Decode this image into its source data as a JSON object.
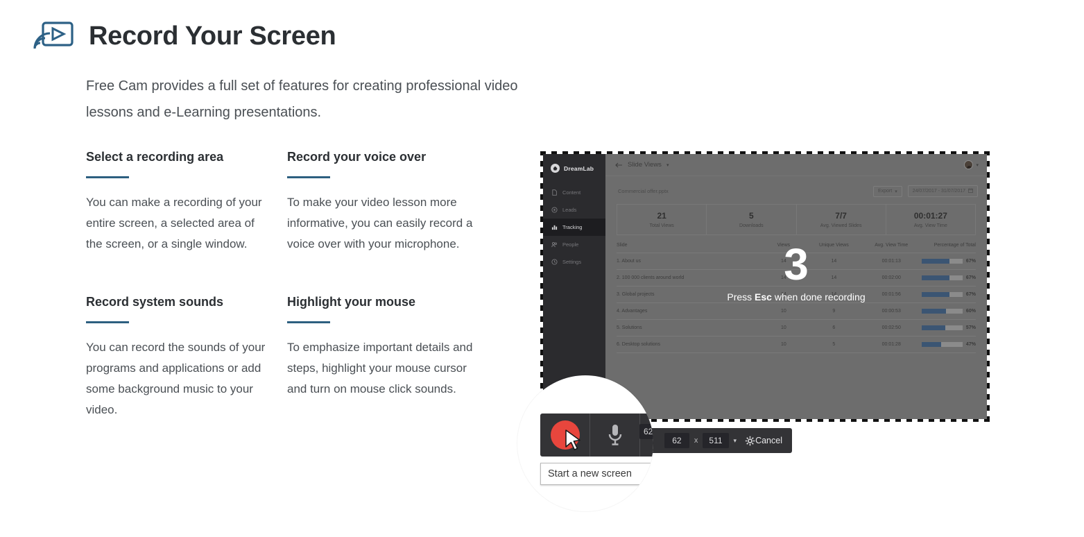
{
  "header": {
    "title": "Record Your Screen",
    "icon": "screen-record-icon",
    "accent_color": "#2d5f80",
    "intro": "Free Cam provides a full set of features for creating professional video lessons and e-Learning presentations."
  },
  "features": [
    {
      "title": "Select a recording area",
      "body": "You can make a recording of your entire screen, a selected area of the screen, or a single window."
    },
    {
      "title": "Record your voice over",
      "body": "To make your video lesson more informative, you can easily record a voice over with your microphone."
    },
    {
      "title": "Record system sounds",
      "body": "You can record the sounds of your programs and applications or add some background music to your video."
    },
    {
      "title": "Highlight your mouse",
      "body": "To emphasize important details and steps, highlight your mouse cursor and turn on mouse click sounds."
    }
  ],
  "screenshot": {
    "sidebar": {
      "logo": "DreamLab",
      "items": [
        {
          "label": "Content",
          "icon": "document-icon",
          "active": false
        },
        {
          "label": "Leads",
          "icon": "target-icon",
          "active": false
        },
        {
          "label": "Tracking",
          "icon": "bar-chart-icon",
          "active": true
        },
        {
          "label": "People",
          "icon": "people-icon",
          "active": false
        },
        {
          "label": "Settings",
          "icon": "clock-icon",
          "active": false
        }
      ]
    },
    "topbar": {
      "back_icon": "arrow-left-icon",
      "title": "Slide Views",
      "caret": "▾",
      "avatar": "user-avatar"
    },
    "filebar": {
      "file_name": "Commercial offer.pptx",
      "export_label": "Export",
      "export_caret": "▾",
      "date_range": "24/07/2017 - 31/07/2017",
      "calendar_icon": "calendar-icon"
    },
    "stats": [
      {
        "value": "21",
        "label": "Total Views"
      },
      {
        "value": "5",
        "label": "Downloads"
      },
      {
        "value": "7/7",
        "label": "Avg. Viewed Slides"
      },
      {
        "value": "00:01:27",
        "label": "Avg. View Time"
      }
    ],
    "table": {
      "columns": [
        "Slide",
        "Views",
        "Unique Views",
        "Avg. View Time",
        "Percentage of Total"
      ],
      "rows": [
        {
          "slide": "1. About us",
          "views": "14",
          "unique": "14",
          "time": "00:01:13",
          "pct": "67%",
          "pct_value": 67
        },
        {
          "slide": "2. 100 000 clients around world",
          "views": "14",
          "unique": "14",
          "time": "00:02:00",
          "pct": "67%",
          "pct_value": 67
        },
        {
          "slide": "3. Global projects",
          "views": "14",
          "unique": "14",
          "time": "00:01:56",
          "pct": "67%",
          "pct_value": 67
        },
        {
          "slide": "4. Advantages",
          "views": "10",
          "unique": "9",
          "time": "00:00:53",
          "pct": "60%",
          "pct_value": 60
        },
        {
          "slide": "5. Solutions",
          "views": "10",
          "unique": "6",
          "time": "00:02:50",
          "pct": "57%",
          "pct_value": 57
        },
        {
          "slide": "6. Desktop solutions",
          "views": "10",
          "unique": "5",
          "time": "00:01:28",
          "pct": "47%",
          "pct_value": 47
        }
      ]
    },
    "countdown": {
      "number": "3",
      "hint_prefix": "Press ",
      "hint_key": "Esc",
      "hint_suffix": " when done recording"
    }
  },
  "recorder_bar": {
    "record_button": "record-button",
    "mic_button": "microphone-button",
    "toggle": "audio-toggle",
    "toggle_state": "on",
    "toggle_color": "#2d9b3f",
    "record_color": "#e23b34",
    "width_value": "62",
    "x_separator": "x",
    "height_value": "511",
    "size_caret": "▾",
    "settings_icon": "gear-icon",
    "cancel_label": "Cancel"
  },
  "magnifier": {
    "tooltip": "Start a new screen",
    "cursor": "mouse-cursor",
    "dim_value": "62"
  }
}
